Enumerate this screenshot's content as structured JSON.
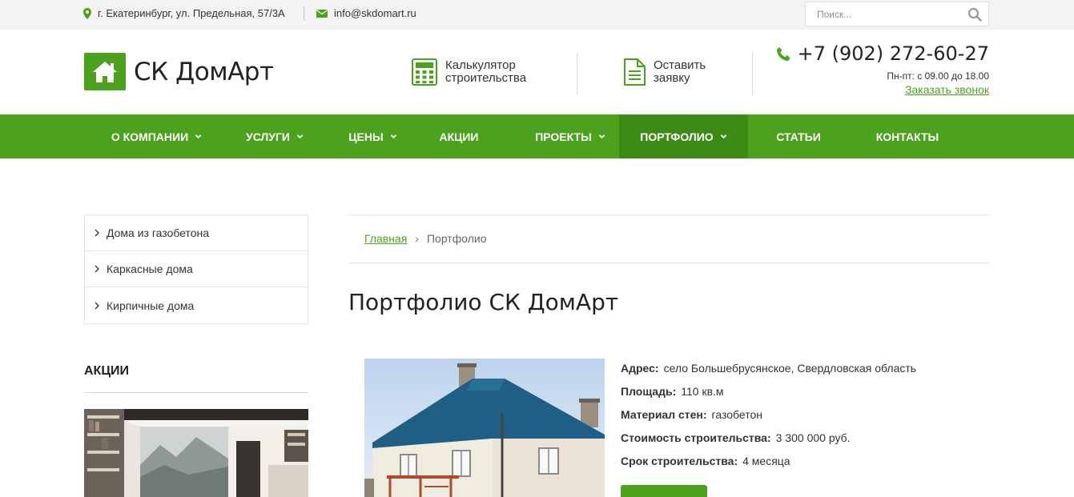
{
  "topbar": {
    "address": "г. Екатеринбург, ул. Предельная, 57/3А",
    "email": "info@skdomart.ru",
    "search_placeholder": "Поиск..."
  },
  "header": {
    "logo_text": "СК ДомАрт",
    "calc_line1": "Калькулятор",
    "calc_line2": "строительства",
    "order_line1": "Оставить",
    "order_line2": "заявку",
    "phone": "+7 (902) 272-60-27",
    "hours": "Пн-пт: с 09.00 до 18.00",
    "callback": "Заказать звонок"
  },
  "nav": {
    "items": [
      {
        "label": "О КОМПАНИИ",
        "dropdown": true
      },
      {
        "label": "УСЛУГИ",
        "dropdown": true
      },
      {
        "label": "ЦЕНЫ",
        "dropdown": true
      },
      {
        "label": "АКЦИИ",
        "dropdown": false
      },
      {
        "label": "ПРОЕКТЫ",
        "dropdown": true
      },
      {
        "label": "ПОРТФОЛИО",
        "dropdown": true,
        "active": true
      },
      {
        "label": "СТАТЬИ",
        "dropdown": false
      },
      {
        "label": "КОНТАКТЫ",
        "dropdown": false
      }
    ]
  },
  "sidebar": {
    "categories": [
      "Дома из газобетона",
      "Каркасные дома",
      "Кирпичные дома"
    ],
    "promo_title": "АКЦИИ"
  },
  "breadcrumb": {
    "home": "Главная",
    "current": "Портфолио"
  },
  "main": {
    "title": "Портфолио СК ДомАрт",
    "project": {
      "fields": [
        {
          "label": "Адрес:",
          "value": "село Большебрусянское, Свердловская область"
        },
        {
          "label": "Площадь:",
          "value": "110 кв.м"
        },
        {
          "label": "Материал стен:",
          "value": "газобетон"
        },
        {
          "label": "Стоимость строительства:",
          "value": "3 300 000 руб."
        },
        {
          "label": "Срок строительства:",
          "value": "4 месяца"
        }
      ]
    }
  },
  "colors": {
    "brand_green": "#4ca21d",
    "nav_active": "#3d8a15",
    "topbar_bg": "#f3f3f3"
  }
}
